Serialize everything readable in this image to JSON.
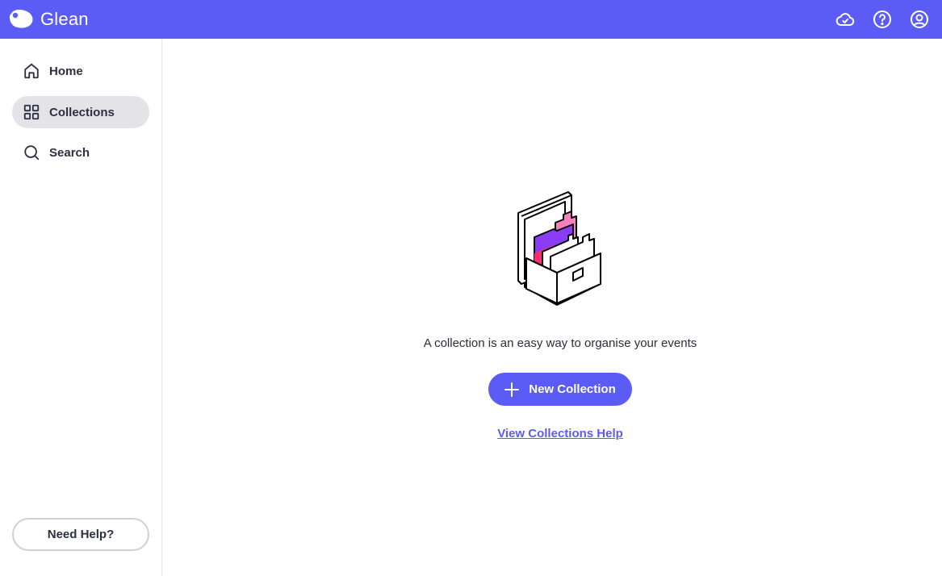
{
  "app": {
    "name": "Glean",
    "accent_color": "#5b5cf6"
  },
  "topbar": {
    "icons": [
      "cloud-sync-icon",
      "help-circle-icon",
      "account-icon"
    ]
  },
  "sidebar": {
    "items": [
      {
        "label": "Home",
        "icon": "home-icon",
        "active": false
      },
      {
        "label": "Collections",
        "icon": "grid-icon",
        "active": true
      },
      {
        "label": "Search",
        "icon": "search-icon",
        "active": false
      }
    ],
    "help_button": "Need Help?"
  },
  "main": {
    "illustration": "file-box-illustration",
    "description": "A collection is an easy way to organise your events",
    "new_collection_button": "New Collection",
    "help_link": "View Collections Help"
  }
}
